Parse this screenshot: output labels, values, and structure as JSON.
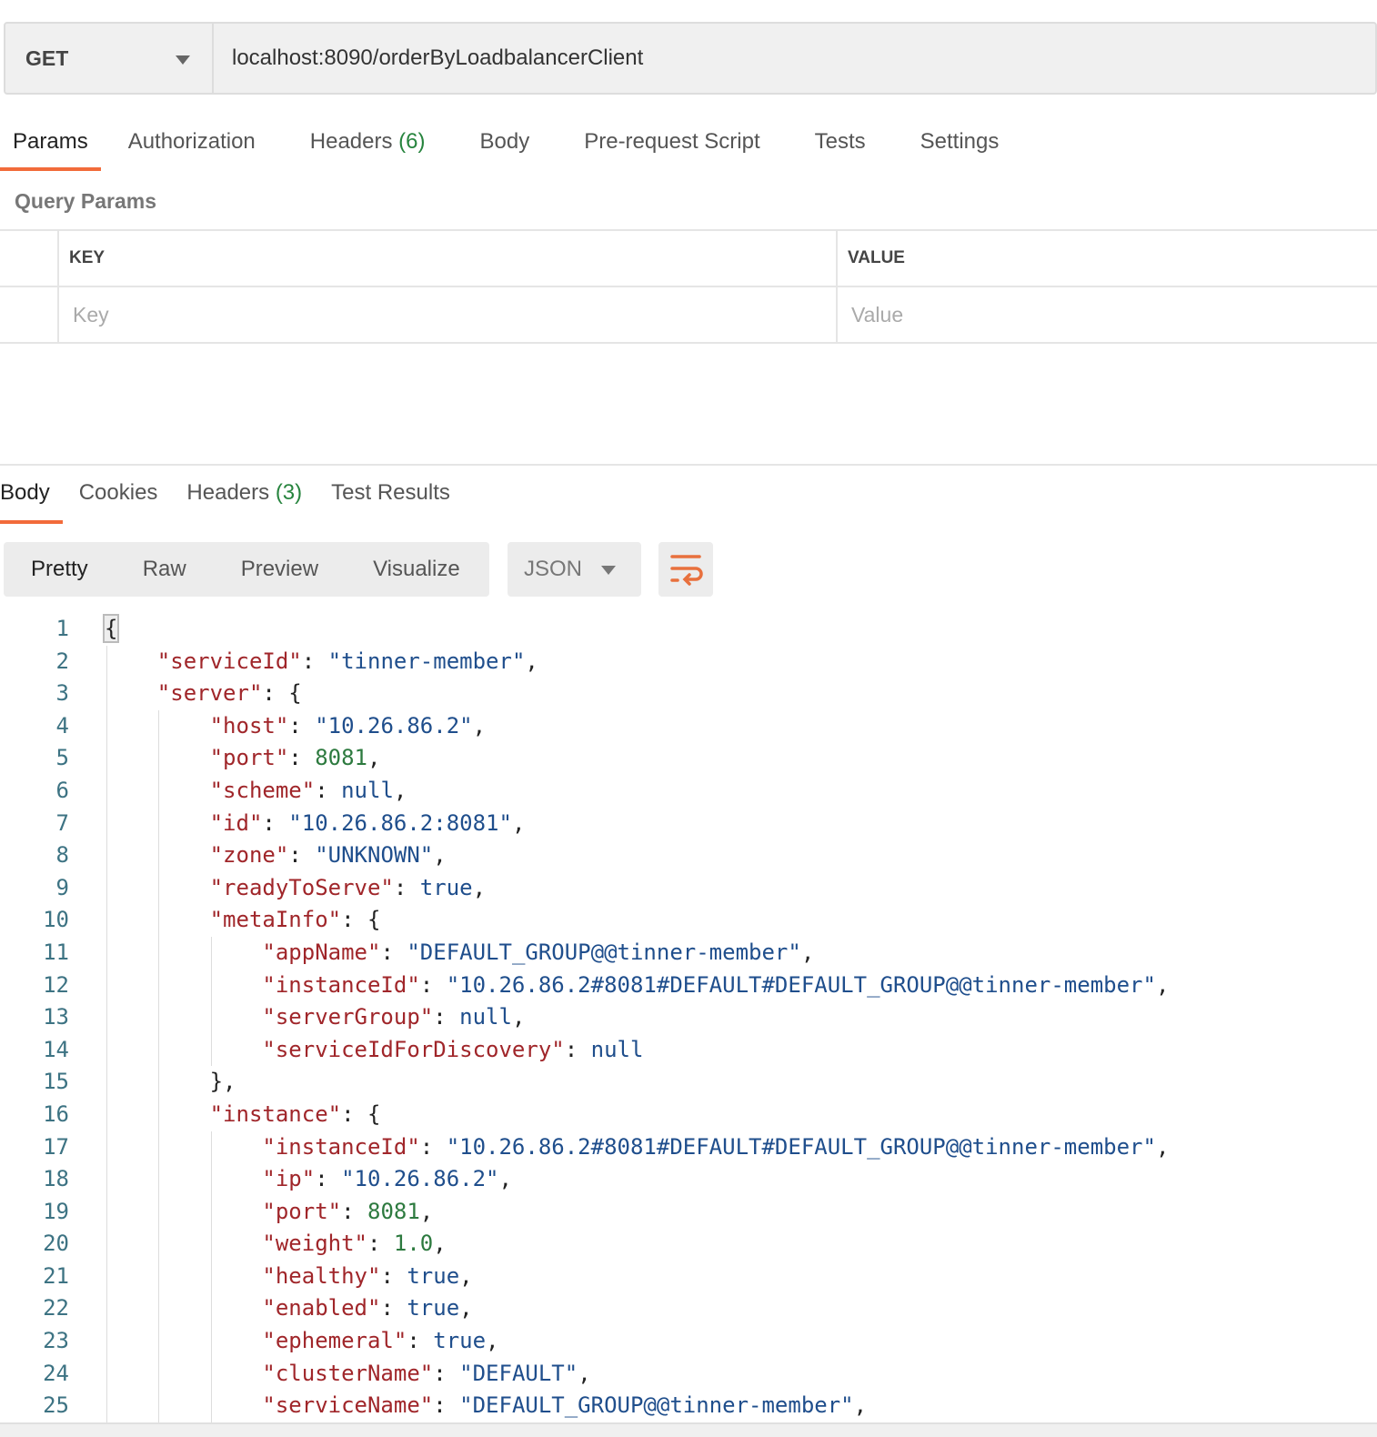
{
  "request": {
    "method": "GET",
    "url": "localhost:8090/orderByLoadbalancerClient"
  },
  "request_tabs": [
    {
      "label": "Params",
      "active": true
    },
    {
      "label": "Authorization"
    },
    {
      "label": "Headers",
      "count": "(6)"
    },
    {
      "label": "Body"
    },
    {
      "label": "Pre-request Script"
    },
    {
      "label": "Tests"
    },
    {
      "label": "Settings"
    }
  ],
  "query_params": {
    "title": "Query Params",
    "key_header": "KEY",
    "value_header": "VALUE",
    "key_placeholder": "Key",
    "value_placeholder": "Value"
  },
  "response_tabs": [
    {
      "label": "Body",
      "active": true
    },
    {
      "label": "Cookies"
    },
    {
      "label": "Headers",
      "count": "(3)"
    },
    {
      "label": "Test Results"
    }
  ],
  "view_modes": [
    "Pretty",
    "Raw",
    "Preview",
    "Visualize"
  ],
  "format": "JSON",
  "accent_color": "#f26b3a",
  "code_lines": [
    [
      0,
      [
        [
          "p",
          "{"
        ]
      ]
    ],
    [
      1,
      [
        [
          "k",
          "\"serviceId\""
        ],
        [
          "p",
          ": "
        ],
        [
          "s",
          "\"tinner-member\""
        ],
        [
          "p",
          ","
        ]
      ]
    ],
    [
      1,
      [
        [
          "k",
          "\"server\""
        ],
        [
          "p",
          ": {"
        ]
      ]
    ],
    [
      2,
      [
        [
          "k",
          "\"host\""
        ],
        [
          "p",
          ": "
        ],
        [
          "s",
          "\"10.26.86.2\""
        ],
        [
          "p",
          ","
        ]
      ]
    ],
    [
      2,
      [
        [
          "k",
          "\"port\""
        ],
        [
          "p",
          ": "
        ],
        [
          "n",
          "8081"
        ],
        [
          "p",
          ","
        ]
      ]
    ],
    [
      2,
      [
        [
          "k",
          "\"scheme\""
        ],
        [
          "p",
          ": "
        ],
        [
          "l",
          "null"
        ],
        [
          "p",
          ","
        ]
      ]
    ],
    [
      2,
      [
        [
          "k",
          "\"id\""
        ],
        [
          "p",
          ": "
        ],
        [
          "s",
          "\"10.26.86.2:8081\""
        ],
        [
          "p",
          ","
        ]
      ]
    ],
    [
      2,
      [
        [
          "k",
          "\"zone\""
        ],
        [
          "p",
          ": "
        ],
        [
          "s",
          "\"UNKNOWN\""
        ],
        [
          "p",
          ","
        ]
      ]
    ],
    [
      2,
      [
        [
          "k",
          "\"readyToServe\""
        ],
        [
          "p",
          ": "
        ],
        [
          "l",
          "true"
        ],
        [
          "p",
          ","
        ]
      ]
    ],
    [
      2,
      [
        [
          "k",
          "\"metaInfo\""
        ],
        [
          "p",
          ": {"
        ]
      ]
    ],
    [
      3,
      [
        [
          "k",
          "\"appName\""
        ],
        [
          "p",
          ": "
        ],
        [
          "s",
          "\"DEFAULT_GROUP@@tinner-member\""
        ],
        [
          "p",
          ","
        ]
      ]
    ],
    [
      3,
      [
        [
          "k",
          "\"instanceId\""
        ],
        [
          "p",
          ": "
        ],
        [
          "s",
          "\"10.26.86.2#8081#DEFAULT#DEFAULT_GROUP@@tinner-member\""
        ],
        [
          "p",
          ","
        ]
      ]
    ],
    [
      3,
      [
        [
          "k",
          "\"serverGroup\""
        ],
        [
          "p",
          ": "
        ],
        [
          "l",
          "null"
        ],
        [
          "p",
          ","
        ]
      ]
    ],
    [
      3,
      [
        [
          "k",
          "\"serviceIdForDiscovery\""
        ],
        [
          "p",
          ": "
        ],
        [
          "l",
          "null"
        ]
      ]
    ],
    [
      2,
      [
        [
          "p",
          "},"
        ]
      ]
    ],
    [
      2,
      [
        [
          "k",
          "\"instance\""
        ],
        [
          "p",
          ": {"
        ]
      ]
    ],
    [
      3,
      [
        [
          "k",
          "\"instanceId\""
        ],
        [
          "p",
          ": "
        ],
        [
          "s",
          "\"10.26.86.2#8081#DEFAULT#DEFAULT_GROUP@@tinner-member\""
        ],
        [
          "p",
          ","
        ]
      ]
    ],
    [
      3,
      [
        [
          "k",
          "\"ip\""
        ],
        [
          "p",
          ": "
        ],
        [
          "s",
          "\"10.26.86.2\""
        ],
        [
          "p",
          ","
        ]
      ]
    ],
    [
      3,
      [
        [
          "k",
          "\"port\""
        ],
        [
          "p",
          ": "
        ],
        [
          "n",
          "8081"
        ],
        [
          "p",
          ","
        ]
      ]
    ],
    [
      3,
      [
        [
          "k",
          "\"weight\""
        ],
        [
          "p",
          ": "
        ],
        [
          "n",
          "1.0"
        ],
        [
          "p",
          ","
        ]
      ]
    ],
    [
      3,
      [
        [
          "k",
          "\"healthy\""
        ],
        [
          "p",
          ": "
        ],
        [
          "l",
          "true"
        ],
        [
          "p",
          ","
        ]
      ]
    ],
    [
      3,
      [
        [
          "k",
          "\"enabled\""
        ],
        [
          "p",
          ": "
        ],
        [
          "l",
          "true"
        ],
        [
          "p",
          ","
        ]
      ]
    ],
    [
      3,
      [
        [
          "k",
          "\"ephemeral\""
        ],
        [
          "p",
          ": "
        ],
        [
          "l",
          "true"
        ],
        [
          "p",
          ","
        ]
      ]
    ],
    [
      3,
      [
        [
          "k",
          "\"clusterName\""
        ],
        [
          "p",
          ": "
        ],
        [
          "s",
          "\"DEFAULT\""
        ],
        [
          "p",
          ","
        ]
      ]
    ],
    [
      3,
      [
        [
          "k",
          "\"serviceName\""
        ],
        [
          "p",
          ": "
        ],
        [
          "s",
          "\"DEFAULT_GROUP@@tinner-member\""
        ],
        [
          "p",
          ","
        ]
      ]
    ]
  ]
}
